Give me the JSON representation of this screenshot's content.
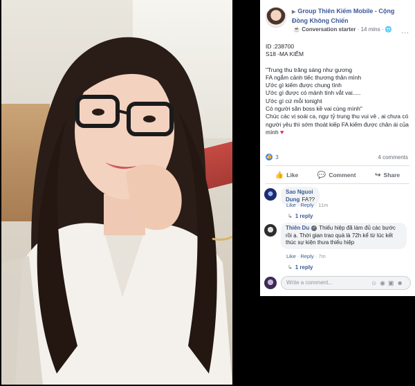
{
  "header": {
    "group_name": "Group Thiên Kiếm Mobile - Cộng Đồng Không Chiến",
    "badge": "Conversation starter",
    "time": "14 mins",
    "more_label": "···"
  },
  "post": {
    "lines": [
      "ID :238700",
      "S18 -MA KIẾM",
      "",
      "\"Trung thu trăng sáng như gương",
      "FA ngắm cảnh tiếc thương thân mình",
      "Ước gì kiếm được chung tình",
      "Ước gì được có mảnh tình vắt vai.....",
      "Ước gì cứ mỗi tonight",
      "Có người săn boss kề vai cùng mình\"",
      "Chúc các vị soái ca, ngự tỷ trung thu vui vẻ , ai chưa có người yêu thì sớm thoát kiếp FA kiếm được chân ái của mình"
    ],
    "heart": "♥"
  },
  "stats": {
    "likes": "3",
    "comments": "4 comments"
  },
  "actions": {
    "like": "Like",
    "comment": "Comment",
    "share": "Share"
  },
  "comments": [
    {
      "name": "Sao Nguoi Dung",
      "text": "FA??",
      "like": "Like",
      "reply": "Reply",
      "time": "11m",
      "replies": "1 reply"
    },
    {
      "name": "Thiên Du",
      "text": "Thiếu hiệp đã làm đủ các bước rồi ạ. Thời gian trao quà là 72h kể từ lúc kết thúc sự kiện thưa thiếu hiệp",
      "like": "Like",
      "reply": "Reply",
      "time": "7m",
      "replies": "1 reply"
    }
  ],
  "write": {
    "placeholder": "Write a comment..."
  },
  "colors": {
    "link": "#385898",
    "like_blue": "#4080ff",
    "heart": "#e0245e"
  }
}
